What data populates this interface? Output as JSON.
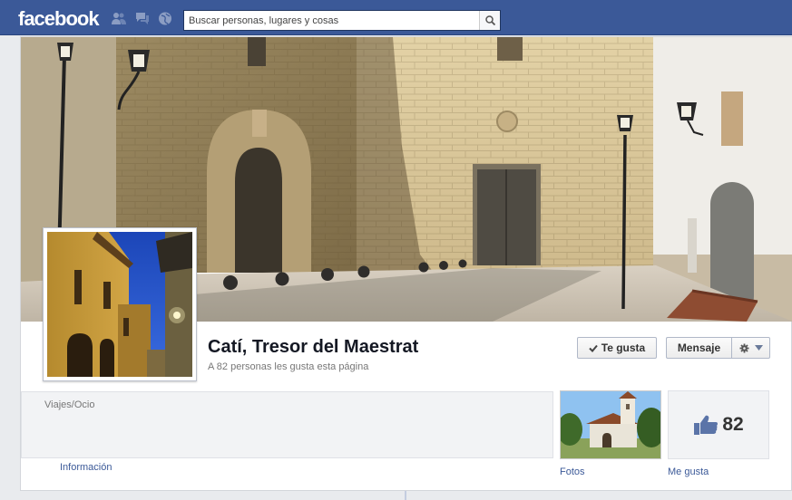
{
  "topbar": {
    "logo": "facebook",
    "search_placeholder": "Buscar personas, lugares y cosas"
  },
  "page": {
    "name": "Catí, Tresor del Maestrat",
    "likes_line": "A 82 personas les gusta esta página",
    "category": "Viajes/Ocio",
    "info_link": "Información"
  },
  "actions": {
    "like_label": "Te gusta",
    "message_label": "Mensaje"
  },
  "apps": {
    "photos_label": "Fotos",
    "likes_label": "Me gusta",
    "likes_count": "82"
  },
  "colors": {
    "brand": "#3b5998",
    "link": "#3b5998"
  },
  "icons": [
    "friends-icon",
    "messages-icon",
    "notifications-icon",
    "search-icon",
    "check-icon",
    "gear-icon",
    "chevron-down-icon",
    "thumbs-up-icon"
  ]
}
